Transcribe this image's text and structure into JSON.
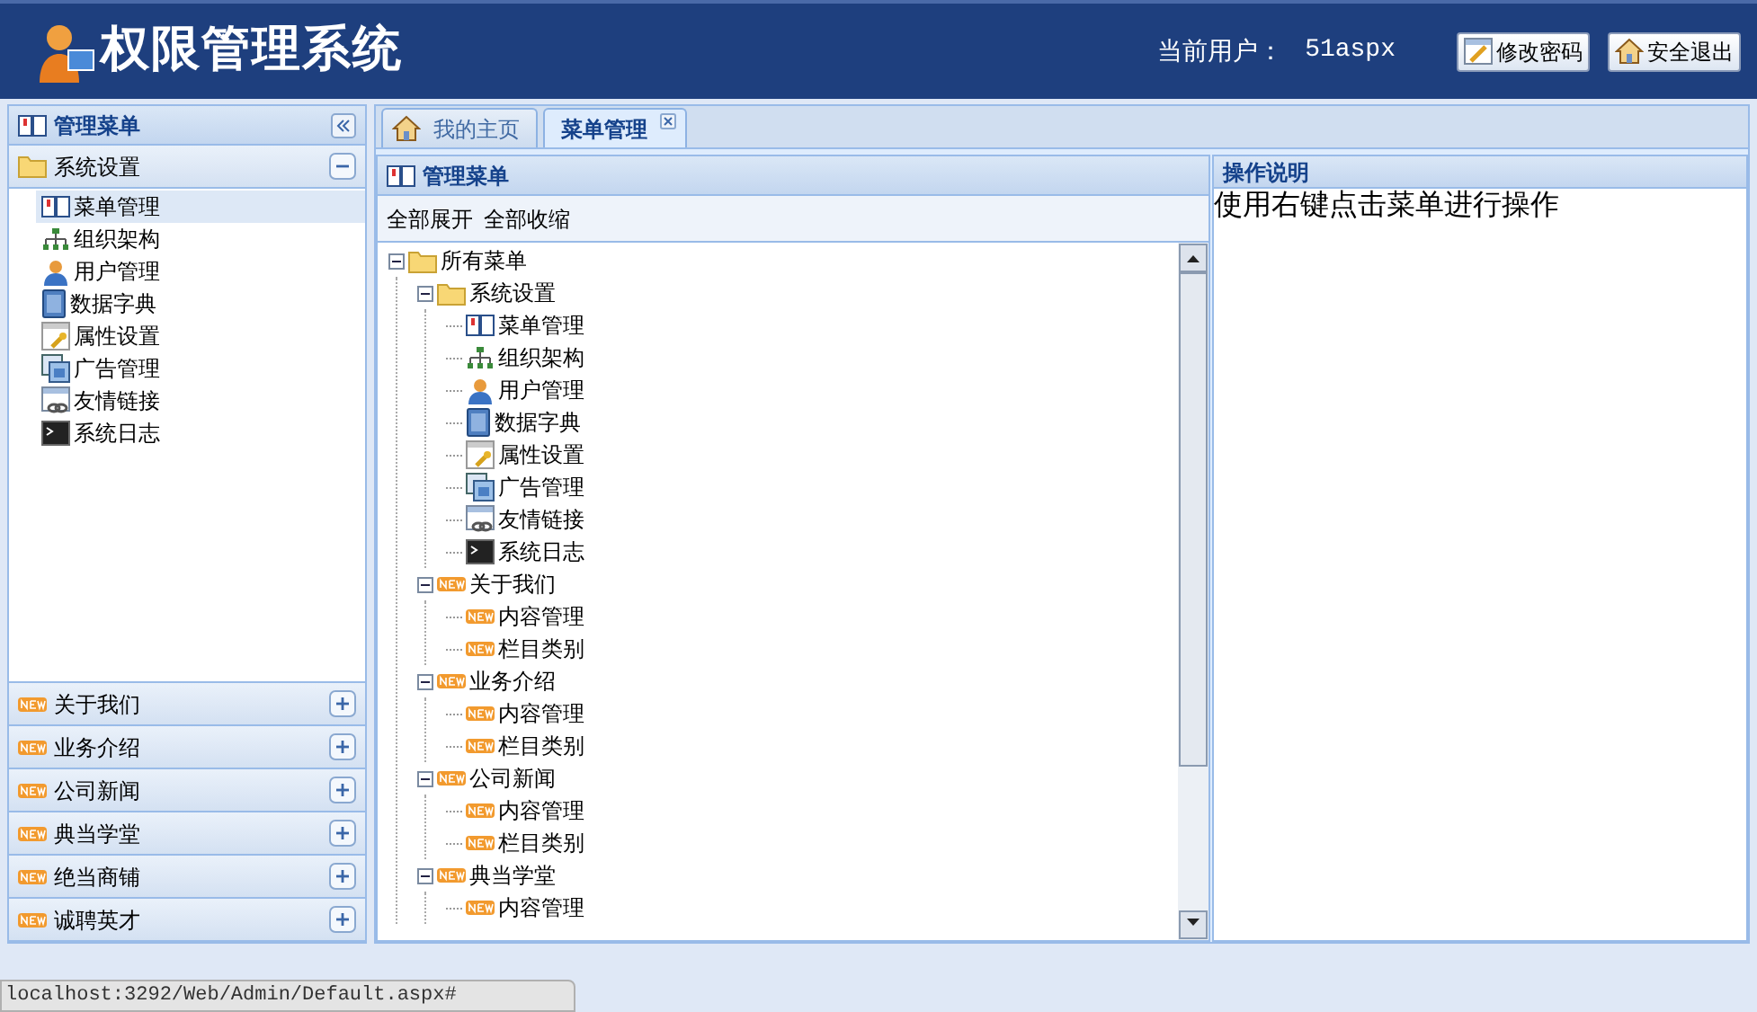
{
  "header": {
    "title": "权限管理系统",
    "user_label": "当前用户：",
    "user_name": "51aspx",
    "buttons": [
      {
        "label": "修改密码",
        "kind": "edit"
      },
      {
        "label": "安全退出",
        "kind": "home"
      }
    ]
  },
  "sidebar": {
    "title": "管理菜单",
    "sections": [
      {
        "label": "系统设置",
        "kind": "folder",
        "expanded": true,
        "items": [
          {
            "label": "菜单管理",
            "kind": "book",
            "selected": true
          },
          {
            "label": "组织架构",
            "kind": "org",
            "selected": false
          },
          {
            "label": "用户管理",
            "kind": "user",
            "selected": false
          },
          {
            "label": "数据字典",
            "kind": "dict",
            "selected": false
          },
          {
            "label": "属性设置",
            "kind": "settings",
            "selected": false
          },
          {
            "label": "广告管理",
            "kind": "ads",
            "selected": false
          },
          {
            "label": "友情链接",
            "kind": "link",
            "selected": false
          },
          {
            "label": "系统日志",
            "kind": "console",
            "selected": false
          }
        ]
      },
      {
        "label": "关于我们",
        "kind": "new",
        "expanded": false
      },
      {
        "label": "业务介绍",
        "kind": "new",
        "expanded": false
      },
      {
        "label": "公司新闻",
        "kind": "new",
        "expanded": false
      },
      {
        "label": "典当学堂",
        "kind": "new",
        "expanded": false
      },
      {
        "label": "绝当商铺",
        "kind": "new",
        "expanded": false
      },
      {
        "label": "诚聘英才",
        "kind": "new",
        "expanded": false
      }
    ]
  },
  "tabs": [
    {
      "label": "我的主页",
      "kind": "home",
      "selected": false,
      "closable": false
    },
    {
      "label": "菜单管理",
      "selected": true,
      "closable": true
    }
  ],
  "menu_panel": {
    "title": "管理菜单",
    "actions": [
      "全部展开",
      "全部收缩"
    ],
    "tree": {
      "label": "所有菜单",
      "kind": "folder",
      "expanded": true,
      "children": [
        {
          "label": "系统设置",
          "kind": "folder",
          "expanded": true,
          "children": [
            {
              "label": "菜单管理",
              "kind": "book"
            },
            {
              "label": "组织架构",
              "kind": "org"
            },
            {
              "label": "用户管理",
              "kind": "user"
            },
            {
              "label": "数据字典",
              "kind": "dict"
            },
            {
              "label": "属性设置",
              "kind": "settings"
            },
            {
              "label": "广告管理",
              "kind": "ads"
            },
            {
              "label": "友情链接",
              "kind": "link"
            },
            {
              "label": "系统日志",
              "kind": "console"
            }
          ]
        },
        {
          "label": "关于我们",
          "kind": "new",
          "expanded": true,
          "children": [
            {
              "label": "内容管理",
              "kind": "new"
            },
            {
              "label": "栏目类别",
              "kind": "new"
            }
          ]
        },
        {
          "label": "业务介绍",
          "kind": "new",
          "expanded": true,
          "children": [
            {
              "label": "内容管理",
              "kind": "new"
            },
            {
              "label": "栏目类别",
              "kind": "new"
            }
          ]
        },
        {
          "label": "公司新闻",
          "kind": "new",
          "expanded": true,
          "children": [
            {
              "label": "内容管理",
              "kind": "new"
            },
            {
              "label": "栏目类别",
              "kind": "new"
            }
          ]
        },
        {
          "label": "典当学堂",
          "kind": "new",
          "expanded": true,
          "children": [
            {
              "label": "内容管理",
              "kind": "new"
            }
          ]
        }
      ]
    }
  },
  "help_panel": {
    "title": "操作说明",
    "text": "使用右键点击菜单进行操作"
  },
  "status_bar": {
    "url": "localhost:3292/Web/Admin/Default.aspx#"
  }
}
